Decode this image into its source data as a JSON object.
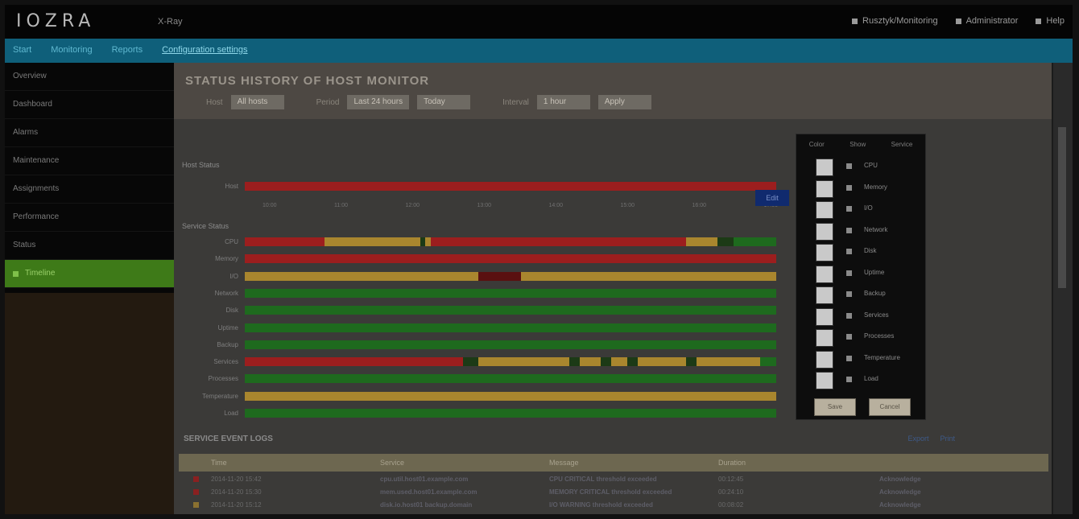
{
  "app": {
    "logo": "IOZRA",
    "logo_sub": "X-Ray",
    "top_right": [
      {
        "icon": "user-icon",
        "label": "Rusztyk/Monitoring"
      },
      {
        "icon": "gear-icon",
        "label": "Administrator"
      },
      {
        "icon": "help-icon",
        "label": "Help"
      }
    ]
  },
  "nav": {
    "tabs": [
      {
        "label": "Start"
      },
      {
        "label": "Monitoring"
      },
      {
        "label": "Reports"
      },
      {
        "label": "Configuration settings"
      }
    ]
  },
  "sidebar": {
    "items": [
      {
        "label": "Overview"
      },
      {
        "label": "Dashboard"
      },
      {
        "label": "Alarms"
      },
      {
        "label": "Maintenance"
      },
      {
        "label": "Assignments"
      },
      {
        "label": "Performance"
      },
      {
        "label": "Status"
      },
      {
        "label": "Timeline",
        "active": true
      }
    ]
  },
  "header": {
    "title": "STATUS HISTORY OF HOST MONITOR",
    "filters": [
      {
        "label": "Host",
        "value": "All hosts"
      },
      {
        "label": "Period",
        "value": "Last 24 hours",
        "value2": "Today"
      },
      {
        "label": "Interval",
        "value": "1 hour",
        "value2": "Apply"
      }
    ]
  },
  "timeline": {
    "host_section": "Host Status",
    "host_row": {
      "label": "Host"
    },
    "time_labels": [
      "10:00",
      "11:00",
      "12:00",
      "13:00",
      "14:00",
      "15:00",
      "16:00",
      "17:00"
    ],
    "services_section": "Service Status",
    "service_rows": [
      {
        "label": "CPU"
      },
      {
        "label": "Memory"
      },
      {
        "label": "I/O"
      },
      {
        "label": "Network"
      },
      {
        "label": "Disk"
      },
      {
        "label": "Uptime"
      },
      {
        "label": "Backup"
      },
      {
        "label": "Services"
      },
      {
        "label": "Processes"
      },
      {
        "label": "Temperature"
      },
      {
        "label": "Load"
      }
    ],
    "colors": {
      "red": "#9c1e1e",
      "dark_red": "#5a1010",
      "orange": "#a9862e",
      "green": "#1e6a1e",
      "dark_green": "#1c3a16"
    }
  },
  "panel": {
    "tab_label": "Edit",
    "headers": [
      "Color",
      "Show",
      "Service"
    ],
    "rows": [
      {
        "label": "CPU"
      },
      {
        "label": "Memory"
      },
      {
        "label": "I/O"
      },
      {
        "label": "Network"
      },
      {
        "label": "Disk"
      },
      {
        "label": "Uptime"
      },
      {
        "label": "Backup"
      },
      {
        "label": "Services"
      },
      {
        "label": "Processes"
      },
      {
        "label": "Temperature"
      },
      {
        "label": "Load"
      }
    ],
    "save_label": "Save",
    "cancel_label": "Cancel"
  },
  "events": {
    "title": "SERVICE EVENT LOGS",
    "links": [
      "Export",
      "Print"
    ],
    "columns": [
      "Time",
      "Service",
      "Message",
      "Duration"
    ],
    "rows": [
      {
        "status": "red",
        "time": "2014-11-20 15:42",
        "service": "cpu.util.host01.example.com",
        "message": "CPU CRITICAL threshold exceeded",
        "duration": "00:12:45",
        "action": "Acknowledge"
      },
      {
        "status": "red",
        "time": "2014-11-20 15:30",
        "service": "mem.used.host01.example.com",
        "message": "MEMORY CRITICAL threshold exceeded",
        "duration": "00:24:10",
        "action": "Acknowledge"
      },
      {
        "status": "orange",
        "time": "2014-11-20 15:12",
        "service": "disk.io.host01 backup.domain",
        "message": "I/O WARNING threshold exceeded",
        "duration": "00:08:02",
        "action": "Acknowledge"
      }
    ]
  }
}
